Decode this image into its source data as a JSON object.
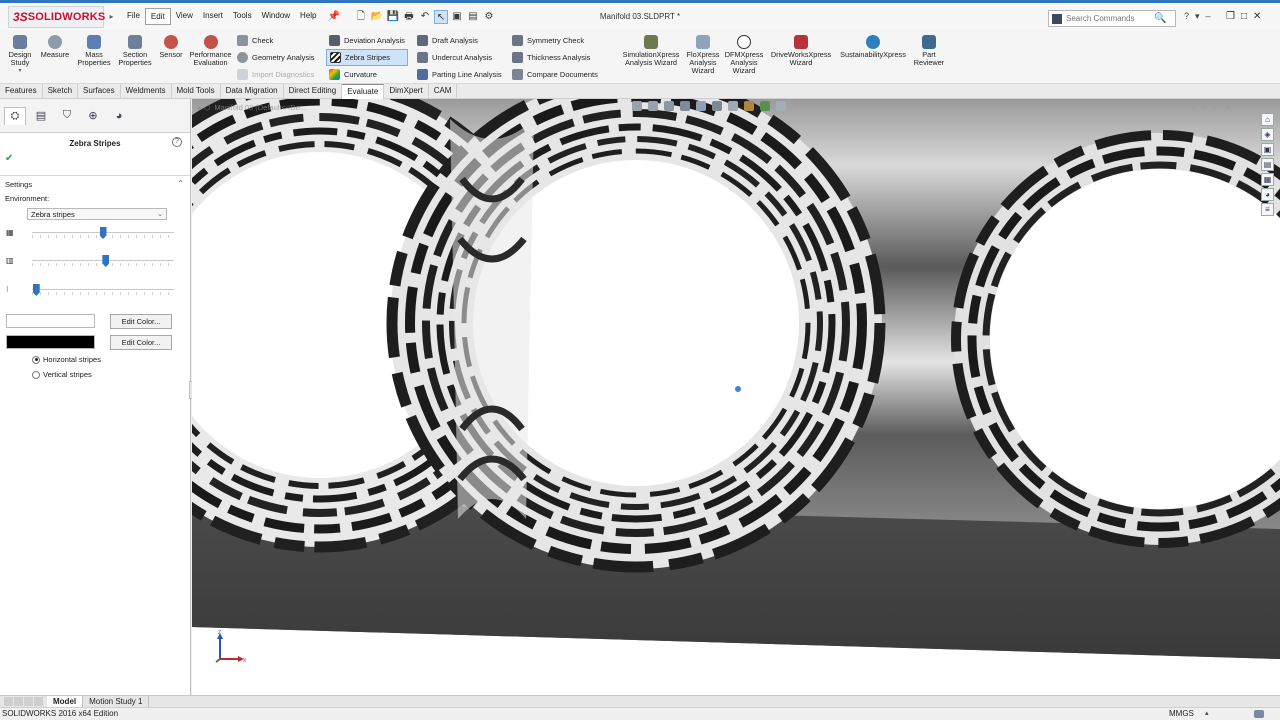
{
  "app": {
    "logo_ds": "3S",
    "logo_name": "SOLIDWORKS"
  },
  "menu": [
    "File",
    "Edit",
    "View",
    "Insert",
    "Tools",
    "Window",
    "Help"
  ],
  "document_title": "Manifold 03.SLDPRT *",
  "search": {
    "placeholder": "Search Commands"
  },
  "ribbon": {
    "design_study": "Design Study",
    "measure": "Measure",
    "mass_properties": "Mass Properties",
    "section_properties": "Section Properties",
    "sensor": "Sensor",
    "performance_evaluation": "Performance Evaluation",
    "check": "Check",
    "geometry_analysis": "Geometry Analysis",
    "import_diagnostics": "Import Diagnostics",
    "deviation_analysis": "Deviation Analysis",
    "zebra_stripes": "Zebra Stripes",
    "curvature": "Curvature",
    "draft_analysis": "Draft Analysis",
    "undercut_analysis": "Undercut Analysis",
    "parting_line_analysis": "Parting Line Analysis",
    "symmetry_check": "Symmetry Check",
    "thickness_analysis": "Thickness Analysis",
    "compare_documents": "Compare Documents",
    "simulationxpress": "SimulationXpress Analysis Wizard",
    "floxpress": "FloXpress Analysis Wizard",
    "dfmxpress": "DFMXpress Analysis Wizard",
    "driveworksxpress": "DriveWorksXpress Wizard",
    "sustainabilityxpress": "SustainabilityXpress",
    "part_reviewer": "Part Reviewer"
  },
  "tabs": [
    "Features",
    "Sketch",
    "Surfaces",
    "Weldments",
    "Mold Tools",
    "Data Migration",
    "Direct Editing",
    "Evaluate",
    "DimXpert",
    "CAM"
  ],
  "active_tab": "Evaluate",
  "property_manager": {
    "title": "Zebra Stripes",
    "settings_label": "Settings",
    "environment_label": "Environment:",
    "environment_value": "Zebra stripes",
    "sliders": [
      {
        "name": "number-of-stripes",
        "fraction": 0.5
      },
      {
        "name": "stripe-width",
        "fraction": 0.52
      },
      {
        "name": "precision",
        "fraction": 0.03
      }
    ],
    "edit_color_label": "Edit Color...",
    "color_1": "#ffffff",
    "color_2": "#000000",
    "horizontal_stripes": "Horizontal stripes",
    "vertical_stripes": "Vertical stripes",
    "selected_orientation": "horizontal"
  },
  "graphics": {
    "tree_flyout": "Manifold 03 (Default<<De..."
  },
  "bottom_tabs": [
    "Model",
    "Motion Study 1"
  ],
  "status": {
    "edition": "SOLIDWORKS 2016 x64 Edition",
    "units": "MMGS"
  }
}
